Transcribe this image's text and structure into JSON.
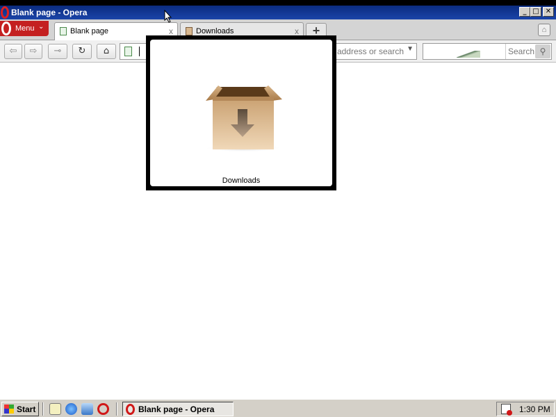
{
  "window": {
    "title": "Blank page - Opera",
    "controls": {
      "minimize": "_",
      "maximize": "□",
      "close": "✕"
    }
  },
  "tabstrip": {
    "menu_label": "Menu",
    "tabs": [
      {
        "label": "Blank page",
        "close": "x",
        "active": true
      },
      {
        "label": "Downloads",
        "close": "x",
        "active": false
      }
    ],
    "new_tab": "+"
  },
  "navbar": {
    "address_placeholder": "r address or search",
    "search_placeholder": "Search"
  },
  "preview": {
    "label": "Downloads"
  },
  "taskbar": {
    "start_label": "Start",
    "task_label": "Blank page - Opera",
    "clock": "1:30 PM"
  },
  "colors": {
    "titlebar": "#0a246a",
    "menu_button": "#c42020",
    "taskbar": "#d4d0c8"
  }
}
